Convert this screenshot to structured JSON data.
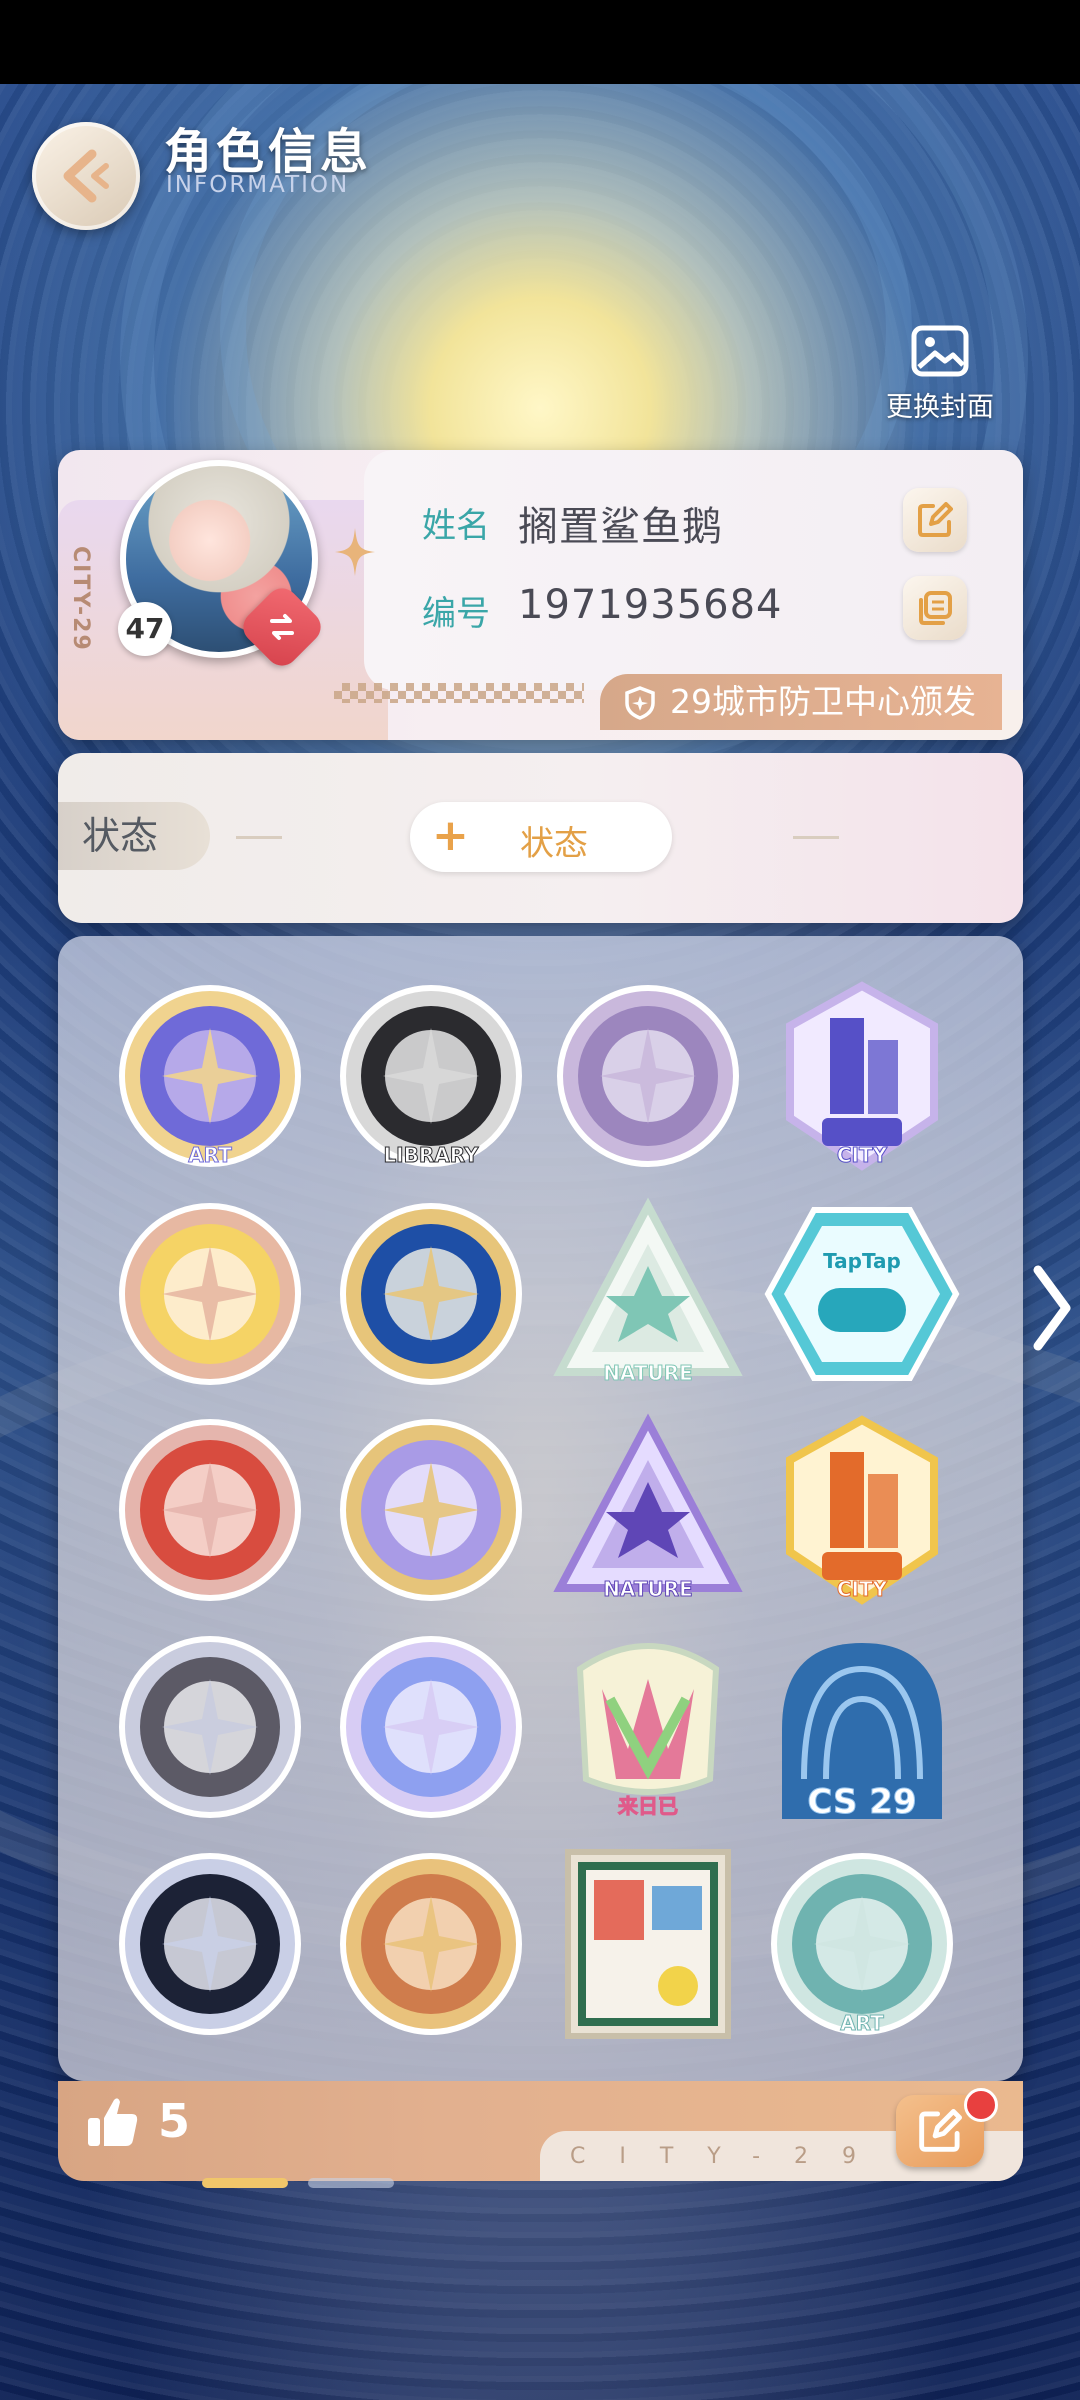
{
  "header": {
    "title": "角色信息",
    "subtitle": "INFORMATION"
  },
  "cover": {
    "label": "更换封面"
  },
  "profile": {
    "level": "47",
    "city_tag": "CITY-29",
    "name_label": "姓名",
    "name_value": "搁置鲨鱼鹅",
    "id_label": "编号",
    "id_value": "1971935684",
    "issuer": "29城市防卫中心颁发"
  },
  "status": {
    "tag": "状态",
    "add_label": "状态",
    "add_icon": "+"
  },
  "badges": [
    {
      "name": "art-badge-purple",
      "caption": "ART"
    },
    {
      "name": "library-badge",
      "caption": "LIBRARY"
    },
    {
      "name": "nature-forest-badge",
      "caption": ""
    },
    {
      "name": "city-badge-purple",
      "caption": "CITY"
    },
    {
      "name": "portrait-badge-blonde",
      "caption": ""
    },
    {
      "name": "compass-badge-blue",
      "caption": ""
    },
    {
      "name": "nature-leaf-badge-white",
      "caption": "NATURE"
    },
    {
      "name": "taptap-badge",
      "caption": "TapTap"
    },
    {
      "name": "portrait-badge-redhair",
      "caption": ""
    },
    {
      "name": "compass-badge-purple",
      "caption": ""
    },
    {
      "name": "nature-leaf-badge-purple",
      "caption": "NATURE"
    },
    {
      "name": "city-badge-orange",
      "caption": "CITY"
    },
    {
      "name": "portrait-badge-glasses",
      "caption": ""
    },
    {
      "name": "compass-badge-holo",
      "caption": ""
    },
    {
      "name": "hands-badge",
      "caption": "来日已"
    },
    {
      "name": "cs29-badge",
      "caption": "CS 29"
    },
    {
      "name": "portrait-badge-boy",
      "caption": ""
    },
    {
      "name": "compass-badge-gold",
      "caption": ""
    },
    {
      "name": "painting-frame-badge",
      "caption": ""
    },
    {
      "name": "art-badge-teal",
      "caption": "ART"
    }
  ],
  "footer": {
    "likes": "5",
    "city_text": "CITY-29"
  },
  "pager": {
    "current": 1,
    "total": 2
  },
  "colors": {
    "accent_teal": "#3aa6a8",
    "accent_orange": "#e3a046",
    "issuer": "#d6a88a"
  }
}
